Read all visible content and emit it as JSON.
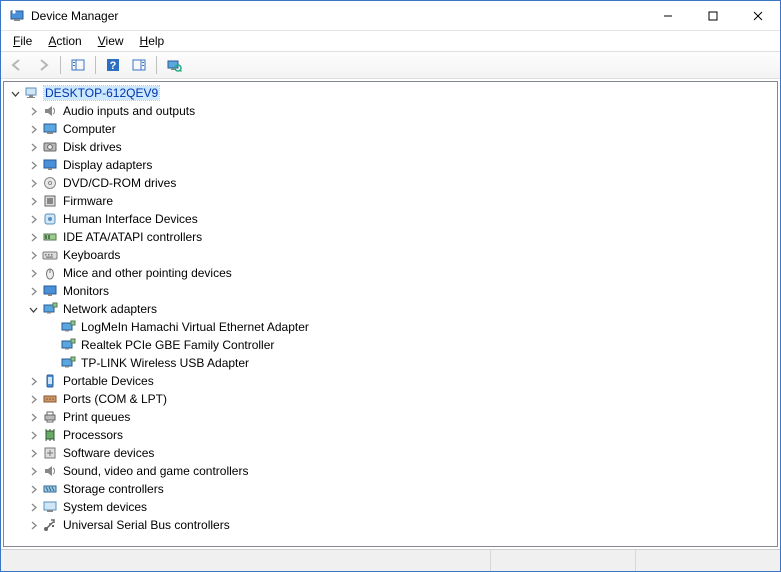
{
  "window": {
    "title": "Device Manager"
  },
  "menu": {
    "file": "File",
    "action": "Action",
    "view": "View",
    "help": "Help"
  },
  "tree": {
    "root": "DESKTOP-612QEV9",
    "categories": [
      {
        "label": "Audio inputs and outputs",
        "icon": "audio"
      },
      {
        "label": "Computer",
        "icon": "computer"
      },
      {
        "label": "Disk drives",
        "icon": "disk"
      },
      {
        "label": "Display adapters",
        "icon": "display"
      },
      {
        "label": "DVD/CD-ROM drives",
        "icon": "dvd"
      },
      {
        "label": "Firmware",
        "icon": "firmware"
      },
      {
        "label": "Human Interface Devices",
        "icon": "hid"
      },
      {
        "label": "IDE ATA/ATAPI controllers",
        "icon": "ide"
      },
      {
        "label": "Keyboards",
        "icon": "keyboard"
      },
      {
        "label": "Mice and other pointing devices",
        "icon": "mouse"
      },
      {
        "label": "Monitors",
        "icon": "monitor"
      },
      {
        "label": "Network adapters",
        "icon": "network",
        "expanded": true,
        "children": [
          {
            "label": "LogMeIn Hamachi Virtual Ethernet Adapter",
            "icon": "nic"
          },
          {
            "label": "Realtek PCIe GBE Family Controller",
            "icon": "nic"
          },
          {
            "label": "TP-LINK Wireless USB Adapter",
            "icon": "nic"
          }
        ]
      },
      {
        "label": "Portable Devices",
        "icon": "portable"
      },
      {
        "label": "Ports (COM & LPT)",
        "icon": "ports"
      },
      {
        "label": "Print queues",
        "icon": "print"
      },
      {
        "label": "Processors",
        "icon": "cpu"
      },
      {
        "label": "Software devices",
        "icon": "software"
      },
      {
        "label": "Sound, video and game controllers",
        "icon": "sound"
      },
      {
        "label": "Storage controllers",
        "icon": "storage"
      },
      {
        "label": "System devices",
        "icon": "system"
      },
      {
        "label": "Universal Serial Bus controllers",
        "icon": "usb"
      }
    ]
  }
}
